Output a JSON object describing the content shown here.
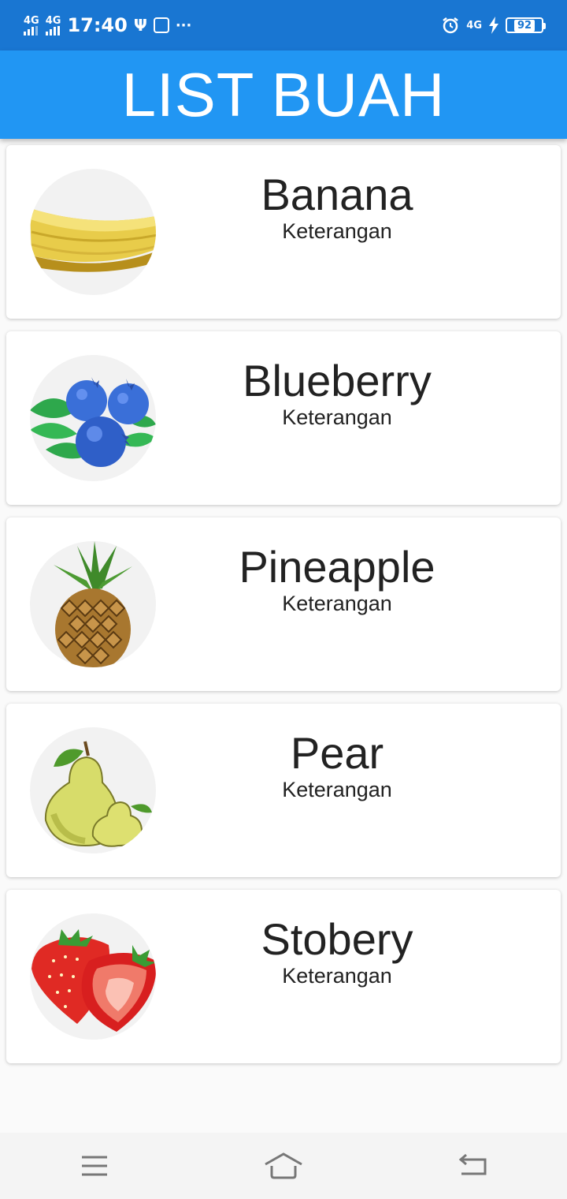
{
  "status_bar": {
    "network_1": "4G",
    "network_2": "4G",
    "time": "17:40",
    "more": "···",
    "network_3": "4G",
    "battery_level": "92"
  },
  "app_bar": {
    "title": "LIST BUAH"
  },
  "fruits": [
    {
      "name": "Banana",
      "subtitle": "Keterangan",
      "icon": "banana-icon"
    },
    {
      "name": "Blueberry",
      "subtitle": "Keterangan",
      "icon": "blueberry-icon"
    },
    {
      "name": "Pineapple",
      "subtitle": "Keterangan",
      "icon": "pineapple-icon"
    },
    {
      "name": "Pear",
      "subtitle": "Keterangan",
      "icon": "pear-icon"
    },
    {
      "name": "Stobery",
      "subtitle": "Keterangan",
      "icon": "strawberry-icon"
    }
  ],
  "nav_bar": {
    "icons": [
      "menu-icon",
      "home-icon",
      "back-icon"
    ]
  },
  "colors": {
    "status_bar": "#1976d2",
    "app_bar": "#2196f3"
  }
}
